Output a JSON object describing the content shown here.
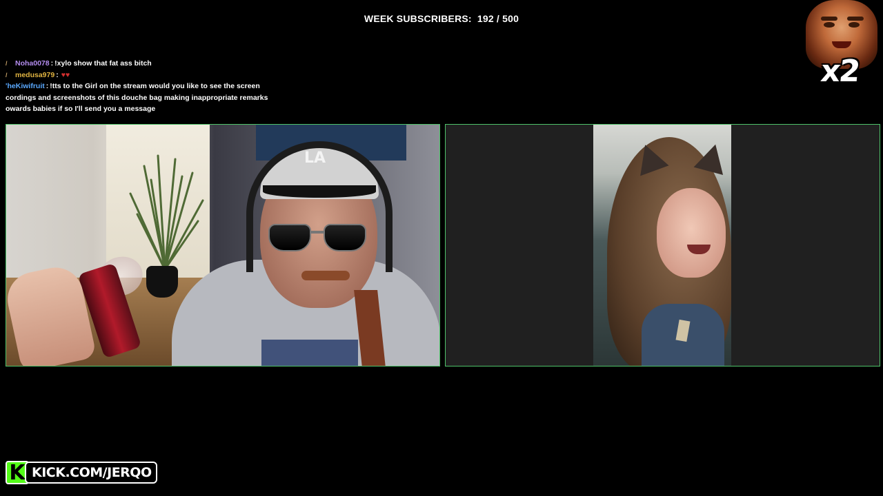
{
  "header": {
    "subscribers_label": "WEEK SUBSCRIBERS:",
    "subscribers_value": "192 / 500"
  },
  "chat": {
    "messages": [
      {
        "user": "Noha0078",
        "colon": ":",
        "text": "!xylo show that fat ass bitch",
        "user_color": "#b48df0",
        "badge": "/"
      },
      {
        "user": "medusa979",
        "colon": ":",
        "text": "",
        "user_color": "#e0b341",
        "badge": "/",
        "emote": "♥♥"
      },
      {
        "user": "'heKiwifruit",
        "colon": ":",
        "text": "!tts to the Girl on the stream would you like to see the screen",
        "user_color": "#5aa9ff"
      }
    ],
    "wrap_lines": [
      "cordings and screenshots of this douche bag making inappropriate remarks",
      "owards babies if so I'll send you a message"
    ]
  },
  "overlay": {
    "multiplier": "x2",
    "meme_icon": "laughing-face-meme"
  },
  "cams": {
    "left": {
      "name": "streamer-cam",
      "cap_logo": "LA"
    },
    "right": {
      "name": "guest-cam"
    }
  },
  "footer": {
    "logo_letter": "K",
    "url": "KICK.COM/JERQO",
    "brand_color": "#53fc18"
  },
  "colors": {
    "cam_border": "#4fc46a",
    "background": "#000000"
  }
}
